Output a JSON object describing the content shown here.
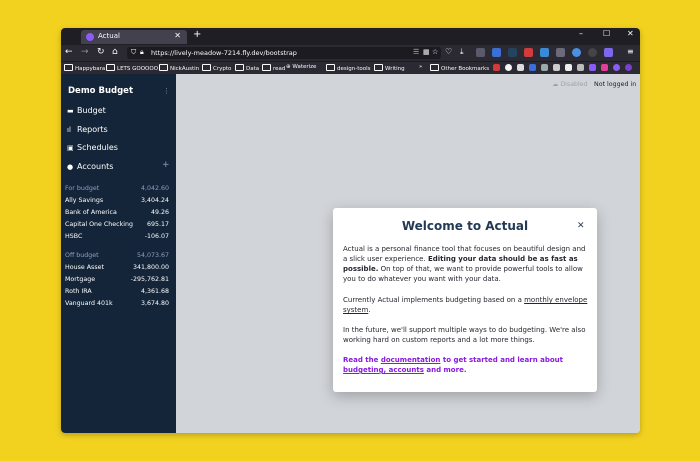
{
  "browser": {
    "tab_title": "Actual",
    "url": "https://lively-meadow-7214.fly.dev/bootstrap",
    "bookmarks": [
      "Happybara",
      "LETS GOOOOO",
      "NickAustin",
      "Crypto",
      "Data",
      "read",
      "Waterize",
      "design-tools",
      "Writing",
      "Other Bookmarks"
    ]
  },
  "sidebar": {
    "budget_name": "Demo Budget",
    "nav": [
      {
        "label": "Budget",
        "icon": "wallet-icon"
      },
      {
        "label": "Reports",
        "icon": "chart-icon"
      },
      {
        "label": "Schedules",
        "icon": "calendar-icon"
      },
      {
        "label": "Accounts",
        "icon": "piggy-bank-icon"
      }
    ],
    "for_budget": {
      "label": "For budget",
      "total": "4,042.60",
      "accounts": [
        {
          "name": "Ally Savings",
          "balance": "3,404.24"
        },
        {
          "name": "Bank of America",
          "balance": "49.26"
        },
        {
          "name": "Capital One Checking",
          "balance": "695.17"
        },
        {
          "name": "HSBC",
          "balance": "-106.07"
        }
      ]
    },
    "off_budget": {
      "label": "Off budget",
      "total": "54,073.67",
      "accounts": [
        {
          "name": "House Asset",
          "balance": "341,800.00"
        },
        {
          "name": "Mortgage",
          "balance": "-295,762.81"
        },
        {
          "name": "Roth IRA",
          "balance": "4,361.68"
        },
        {
          "name": "Vanguard 401k",
          "balance": "3,674.80"
        }
      ]
    }
  },
  "status": {
    "sync": "Disabled",
    "login": "Not logged in"
  },
  "modal": {
    "title": "Welcome to Actual",
    "p1_a": "Actual is a personal finance tool that focuses on beautiful design and a slick user experience.",
    "p1_bold": "Editing your data should be as fast as possible.",
    "p1_b": "On top of that, we want to provide powerful tools to allow you to do whatever you want with your data.",
    "p2_a": "Currently Actual implements budgeting based on a",
    "p2_link": "monthly envelope system",
    "p2_b": ".",
    "p3": "In the future, we'll support multiple ways to do budgeting. We're also working hard on custom reports and a lot more things.",
    "p4_a": "Read the",
    "p4_link1": "documentation",
    "p4_b": "to get started and learn about",
    "p4_link2": "budgeting, accounts",
    "p4_c": "and more."
  },
  "colors": {
    "sidebar_bg": "#14253a",
    "accent_link": "#8719e0",
    "main_bg": "#d1d5d9",
    "desktop_bg": "#f2d21f"
  }
}
